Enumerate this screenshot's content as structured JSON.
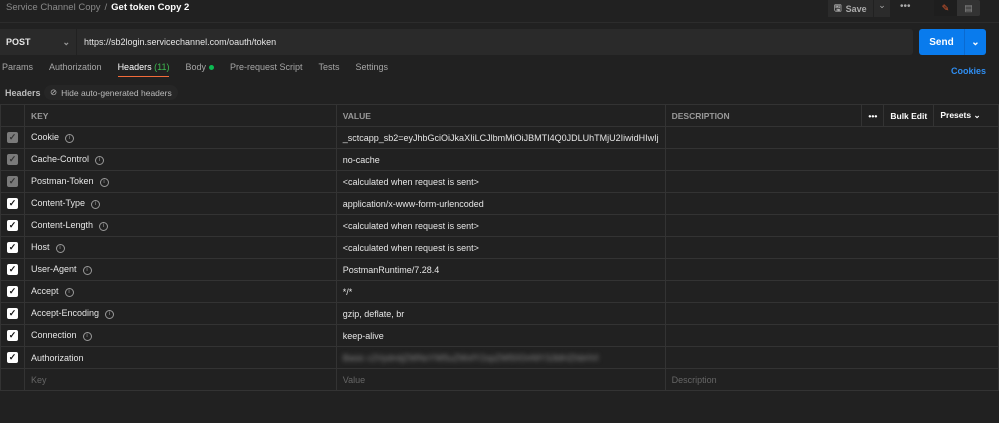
{
  "breadcrumb": {
    "parent": "Service Channel Copy",
    "separator": "/",
    "current": "Get token Copy 2"
  },
  "toolbar": {
    "save": "Save",
    "more": "•••"
  },
  "request": {
    "method": "POST",
    "url": "https://sb2login.servicechannel.com/oauth/token",
    "send": "Send"
  },
  "tabs": [
    {
      "label": "Params"
    },
    {
      "label": "Authorization"
    },
    {
      "label": "Headers",
      "count": "(11)"
    },
    {
      "label": "Body"
    },
    {
      "label": "Pre-request Script"
    },
    {
      "label": "Tests"
    },
    {
      "label": "Settings"
    }
  ],
  "cookies": "Cookies",
  "headers_label": "Headers",
  "hide_auto": "Hide auto-generated headers",
  "columns": {
    "key": "KEY",
    "value": "VALUE",
    "description": "DESCRIPTION",
    "more": "•••",
    "bulk_edit": "Bulk Edit",
    "presets": "Presets"
  },
  "rows": [
    {
      "key": "Cookie",
      "value": "_sctcapp_sb2=eyJhbGciOiJkaXIiLCJlbmMiOiJBMTI4Q0JDLUhTMjU2IiwidHIwIj",
      "auto": true
    },
    {
      "key": "Cache-Control",
      "value": "no-cache",
      "auto": true
    },
    {
      "key": "Postman-Token",
      "value": "<calculated when request is sent>",
      "auto": true
    },
    {
      "key": "Content-Type",
      "value": "application/x-www-form-urlencoded",
      "auto": false
    },
    {
      "key": "Content-Length",
      "value": "<calculated when request is sent>",
      "auto": false
    },
    {
      "key": "Host",
      "value": "<calculated when request is sent>",
      "auto": false
    },
    {
      "key": "User-Agent",
      "value": "PostmanRuntime/7.28.4",
      "auto": false
    },
    {
      "key": "Accept",
      "value": "*/*",
      "auto": false
    },
    {
      "key": "Accept-Encoding",
      "value": "gzip, deflate, br",
      "auto": false
    },
    {
      "key": "Connection",
      "value": "keep-alive",
      "auto": false
    },
    {
      "key": "Authorization",
      "value": "Basic c2VydmljZWNoYW5uZWxfY2xpZW50OnNlY3JldHZhbHVl",
      "auto": false,
      "blurred": true
    }
  ],
  "placeholders": {
    "key": "Key",
    "value": "Value",
    "description": "Description"
  }
}
